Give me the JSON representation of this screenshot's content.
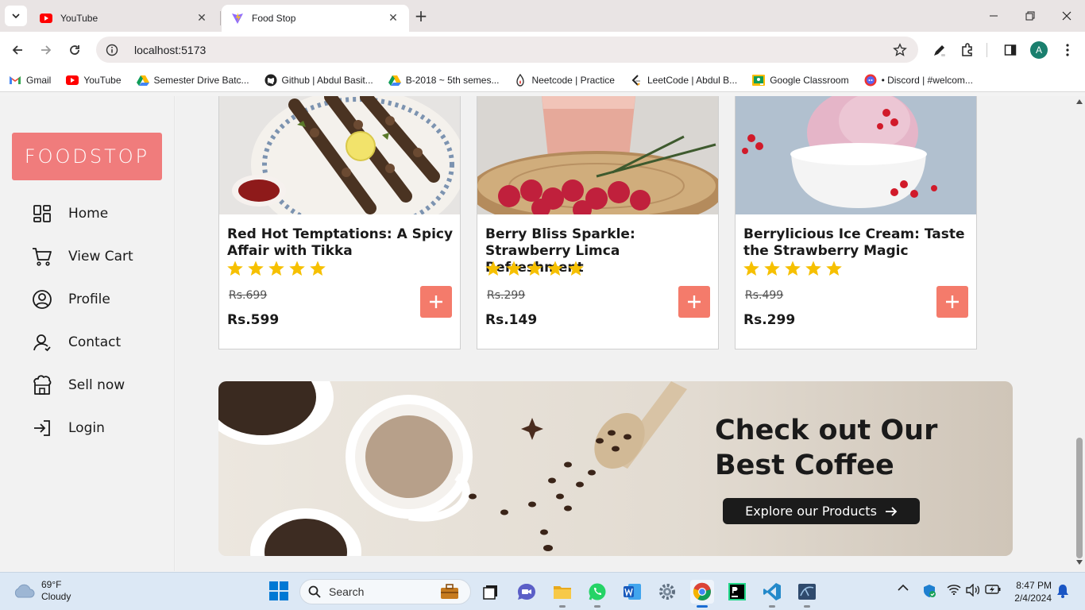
{
  "browser": {
    "tabs": [
      {
        "title": "YouTube",
        "active": false
      },
      {
        "title": "Food Stop",
        "active": true
      }
    ],
    "url": "localhost:5173",
    "profile_initial": "A",
    "bookmarks": [
      {
        "label": "Gmail",
        "icon": "gmail-icon"
      },
      {
        "label": "YouTube",
        "icon": "youtube-icon"
      },
      {
        "label": "Semester Drive Batc...",
        "icon": "google-drive-icon"
      },
      {
        "label": "Github | Abdul Basit...",
        "icon": "github-icon"
      },
      {
        "label": "B-2018 ~ 5th semes...",
        "icon": "google-drive-icon"
      },
      {
        "label": "Neetcode | Practice",
        "icon": "neetcode-icon"
      },
      {
        "label": "LeetCode | Abdul B...",
        "icon": "leetcode-icon"
      },
      {
        "label": "Google Classroom",
        "icon": "classroom-icon"
      },
      {
        "label": "• Discord | #welcom...",
        "icon": "discord-icon"
      }
    ]
  },
  "sidebar": {
    "logo": "FOODSTOP",
    "items": [
      {
        "label": "Home",
        "icon": "dashboard-icon"
      },
      {
        "label": "View Cart",
        "icon": "cart-icon"
      },
      {
        "label": "Profile",
        "icon": "user-circle-icon"
      },
      {
        "label": "Contact",
        "icon": "contact-icon"
      },
      {
        "label": "Sell now",
        "icon": "store-icon"
      },
      {
        "label": "Login",
        "icon": "login-icon"
      }
    ]
  },
  "products": [
    {
      "title": "Red Hot Temptations: A Spicy Affair with Tikka",
      "rating": 5,
      "old_price": "Rs.699",
      "price": "Rs.599"
    },
    {
      "title": "Berry Bliss Sparkle: Strawberry Limca Refreshment",
      "rating": 5,
      "old_price": "Rs.299",
      "price": "Rs.149"
    },
    {
      "title": "Berrylicious Ice Cream: Taste the Strawberry Magic",
      "rating": 5,
      "old_price": "Rs.499",
      "price": "Rs.299"
    }
  ],
  "banner": {
    "title_line1": "Check out Our",
    "title_line2": "Best Coffee",
    "button_label": "Explore our Products"
  },
  "taskbar": {
    "temperature": "69°F",
    "condition": "Cloudy",
    "search_placeholder": "Search",
    "time": "8:47 PM",
    "date": "2/4/2024"
  },
  "colors": {
    "brand": "#f07c7c",
    "add_button": "#f47b6b",
    "star": "#f6c000",
    "dark_button": "#1b1b1b"
  }
}
